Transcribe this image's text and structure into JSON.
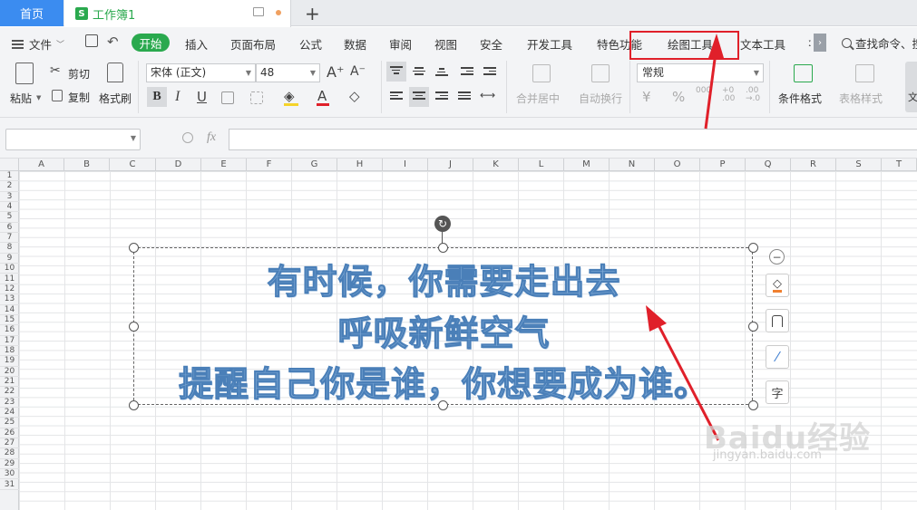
{
  "tabs": {
    "home": "首页",
    "doc_title": "工作簿1",
    "doc_logo": "S"
  },
  "menu": {
    "file": "文件",
    "items": [
      "开始",
      "插入",
      "页面布局",
      "公式",
      "数据",
      "审阅",
      "视图",
      "安全",
      "开发工具",
      "特色功能",
      "绘图工具",
      "文本工具"
    ],
    "search": "查找命令、搜"
  },
  "ribbon": {
    "paste": "粘贴",
    "cut": "剪切",
    "copy": "复制",
    "format_painter": "格式刷",
    "font_name": "宋体 (正文)",
    "font_size": "48",
    "merge_center": "合并居中",
    "wrap_text": "自动换行",
    "number_format": "常规",
    "conditional_format": "条件格式",
    "table_style": "表格样式",
    "text_more": "文"
  },
  "formula": {
    "fx": "fx",
    "value": ""
  },
  "grid": {
    "columns": [
      "A",
      "B",
      "C",
      "D",
      "E",
      "F",
      "G",
      "H",
      "I",
      "J",
      "K",
      "L",
      "M",
      "N",
      "O",
      "P",
      "Q",
      "R",
      "S",
      "T"
    ],
    "rows": [
      "1",
      "2",
      "3",
      "4",
      "5",
      "6",
      "7",
      "8",
      "9",
      "10",
      "11",
      "12",
      "13",
      "14",
      "15",
      "16",
      "17",
      "18",
      "19",
      "20",
      "21",
      "22",
      "23",
      "24",
      "25",
      "26",
      "27",
      "28",
      "29",
      "30",
      "31"
    ]
  },
  "textbox": {
    "lines": [
      "有时候，你需要走出去",
      "呼吸新鲜空气",
      "提醒自己你是谁，你想要成为谁。"
    ]
  },
  "side_toolbar": {
    "text_btn": "字"
  },
  "watermark": {
    "main": "Baidu经验",
    "sub": "jingyan.baidu.com"
  },
  "colors": {
    "accent_green": "#2aa94e",
    "home_tab_blue": "#3b8cf0",
    "annotation_red": "#e0202a",
    "text_fill": "#7ea9d6"
  }
}
